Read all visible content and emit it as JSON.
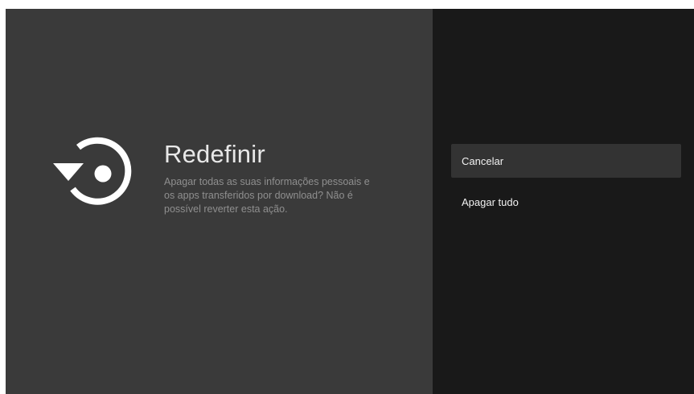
{
  "dialog": {
    "title": "Redefinir",
    "description": "Apagar todas as suas informações pessoais e os apps transferidos por download? Não é possível reverter esta ação.",
    "icon": "reset-icon"
  },
  "actions": [
    {
      "label": "Cancelar",
      "focused": true
    },
    {
      "label": "Apagar tudo",
      "focused": false
    }
  ],
  "colors": {
    "left_background": "#3a3a3a",
    "right_background": "#191919",
    "focused_item": "#333333",
    "title_text": "#e8e8e8",
    "description_text": "#8f8f8f"
  }
}
